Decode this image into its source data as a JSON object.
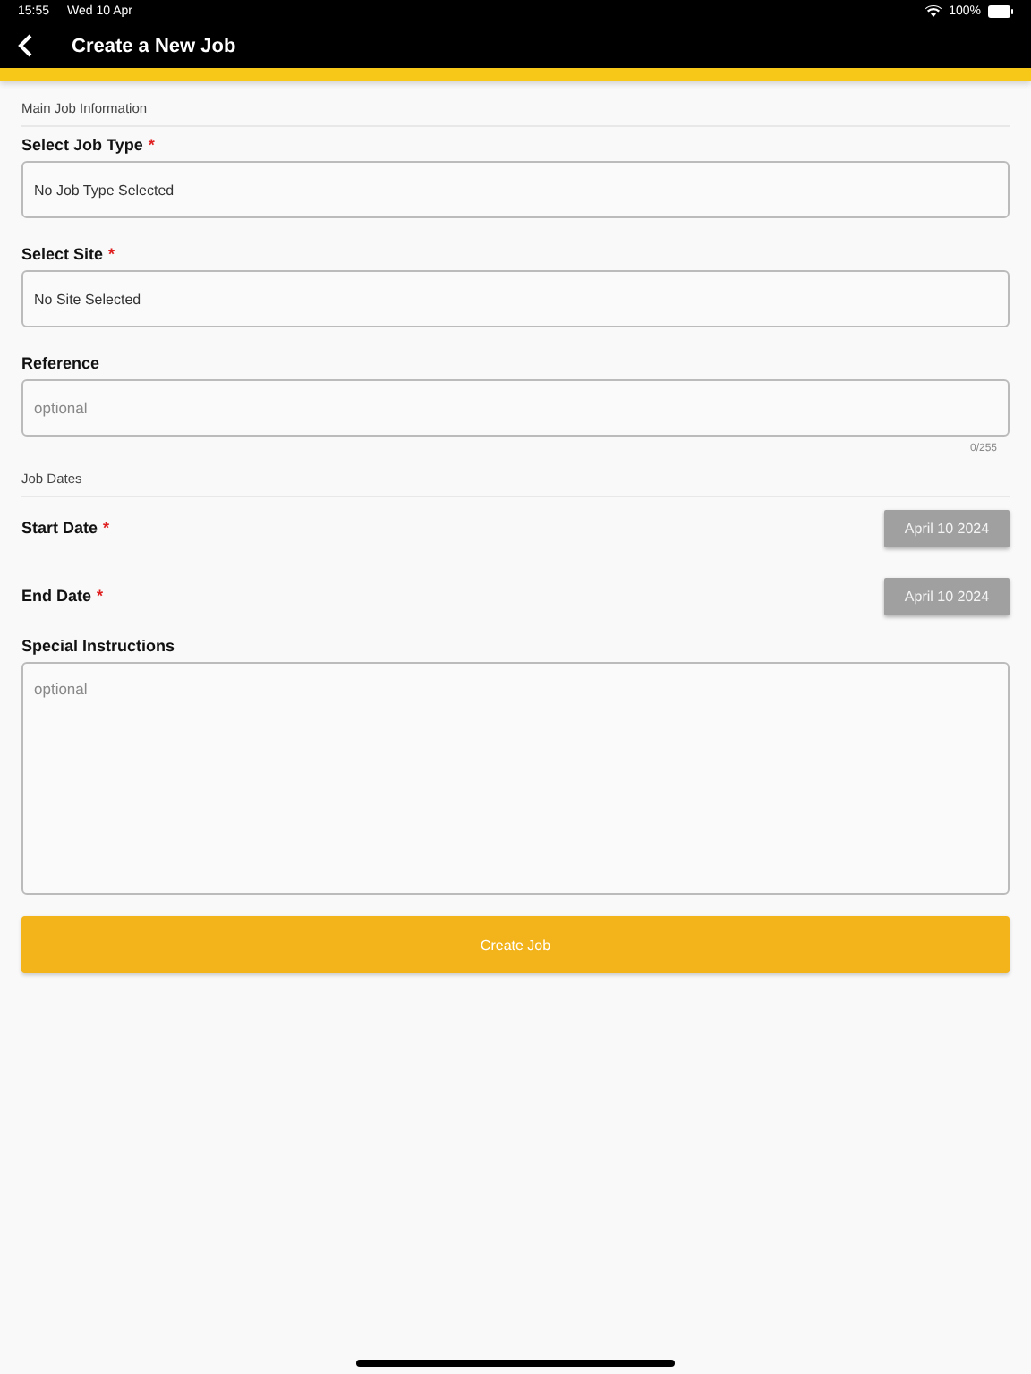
{
  "status_bar": {
    "time": "15:55",
    "date": "Wed 10 Apr",
    "battery": "100%"
  },
  "header": {
    "title": "Create a New Job"
  },
  "sections": [
    {
      "title": "Main Job Information",
      "fields": [
        {
          "kind": "select",
          "label": "Select Job Type",
          "required_mark": "*",
          "value": "No Job Type Selected"
        },
        {
          "kind": "select",
          "label": "Select Site",
          "required_mark": "*",
          "value": "No Site Selected"
        },
        {
          "kind": "text",
          "label": "Reference",
          "placeholder": "optional",
          "counter": "0/255"
        }
      ]
    },
    {
      "title": "Job Dates",
      "fields": [
        {
          "kind": "date",
          "label": "Start Date",
          "required_mark": "*",
          "value": "April 10 2024"
        },
        {
          "kind": "date",
          "label": "End Date",
          "required_mark": "*",
          "value": "April 10 2024"
        },
        {
          "kind": "textarea",
          "label": "Special Instructions",
          "placeholder": "optional"
        }
      ]
    }
  ],
  "submit": "Create Job"
}
